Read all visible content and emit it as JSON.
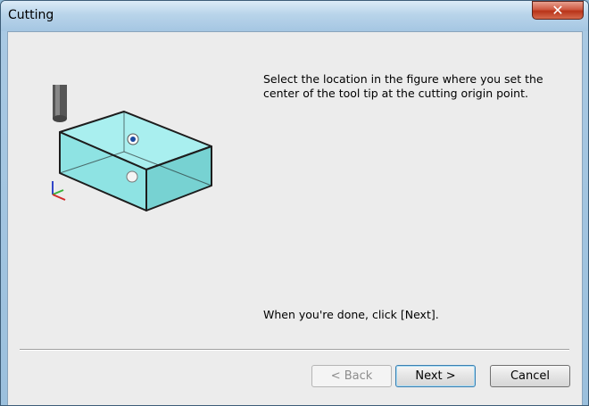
{
  "window": {
    "title": "Cutting"
  },
  "close_icon": "close-icon",
  "content": {
    "instruction": "Select the location in the figure where you set the center of the tool tip at the cutting origin point.",
    "done_text": "When you're done, click [Next]."
  },
  "buttons": {
    "back": "< Back",
    "next": "Next >",
    "cancel": "Cancel"
  },
  "colors": {
    "box_fill": "#8ee3e3",
    "box_stroke": "#1d1d1d",
    "window_accent": "#a5c6e2",
    "close_red": "#c8452b"
  }
}
